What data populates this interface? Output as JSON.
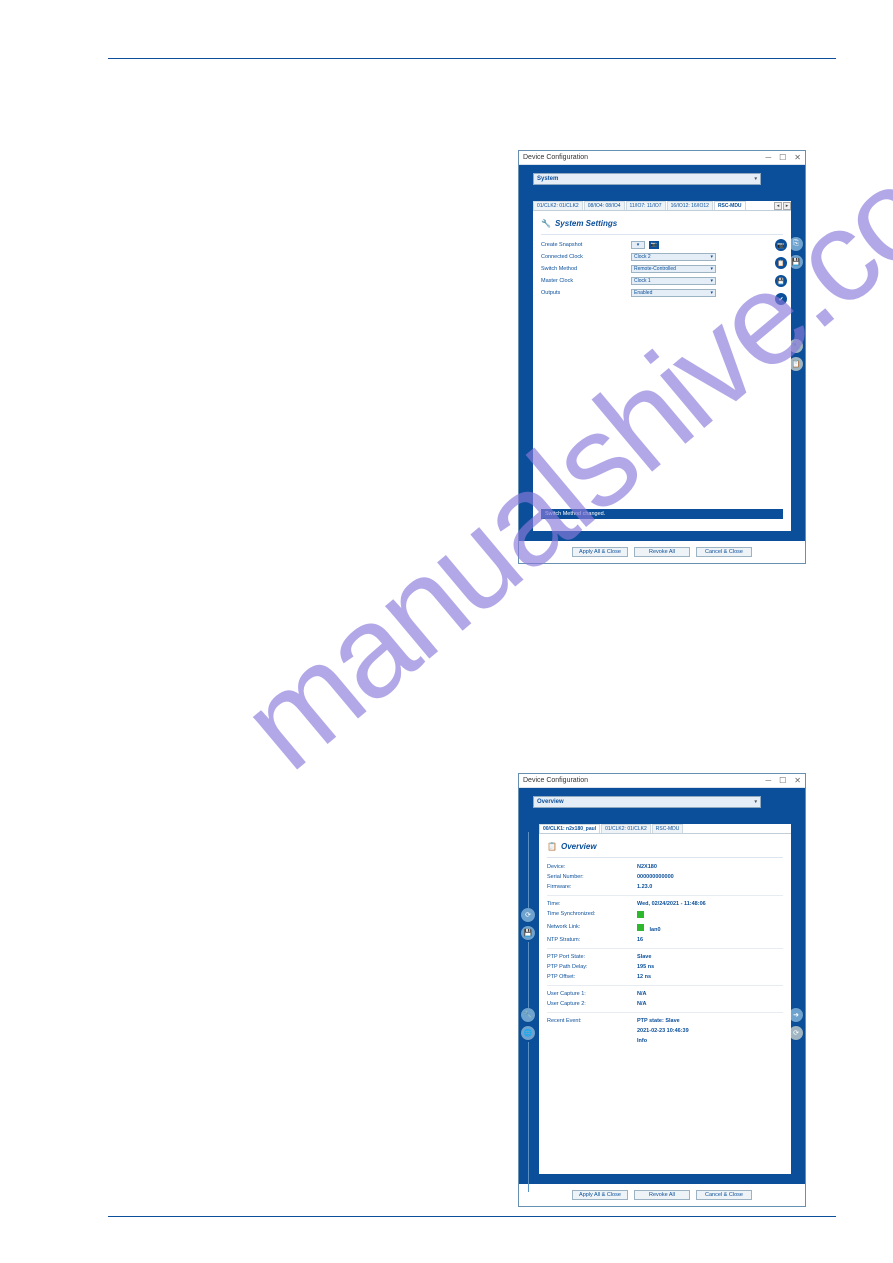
{
  "watermark": "manualshive.com",
  "win1": {
    "title": "Device Configuration",
    "dropdown": "System",
    "tabs": [
      "01/CLK2: 01/CLK2",
      "08/IO4: 08/IO4",
      "11/IO7: 11/IO7",
      "16/IO12: 16/IO12",
      "RSC-MDU"
    ],
    "active_tab_index": 4,
    "heading": "System Settings",
    "rows": {
      "create_snapshot": {
        "label": "Create Snapshot"
      },
      "connected_clock": {
        "label": "Connected Clock",
        "value": "Clock 2"
      },
      "switch_method": {
        "label": "Switch Method",
        "value": "Remote-Controlled"
      },
      "master_clock": {
        "label": "Master Clock",
        "value": "Clock 1"
      },
      "outputs": {
        "label": "Outputs",
        "value": "Enabled"
      }
    },
    "status": "Switch Method changed.",
    "buttons": {
      "apply": "Apply All & Close",
      "revoke": "Revoke All",
      "cancel": "Cancel & Close"
    }
  },
  "win2": {
    "title": "Device Configuration",
    "dropdown": "Overview",
    "tabs": [
      "00/CLK1: n2x180_paul",
      "01/CLK2: 01/CLK2",
      "RSC-MDU"
    ],
    "active_tab_index": 0,
    "heading": "Overview",
    "rows": {
      "device": {
        "label": "Device:",
        "value": "N2X180"
      },
      "serial": {
        "label": "Serial Number:",
        "value": "000000000000"
      },
      "firmware": {
        "label": "Firmware:",
        "value": "1.23.0"
      },
      "time": {
        "label": "Time:",
        "value": "Wed, 02/24/2021 - 11:48:06"
      },
      "tsync": {
        "label": "Time Synchronized:"
      },
      "nlink": {
        "label": "Network Link:",
        "value": "lan0"
      },
      "ntp": {
        "label": "NTP Stratum:",
        "value": "16"
      },
      "ptpstate": {
        "label": "PTP Port State:",
        "value": "Slave"
      },
      "ptpdelay": {
        "label": "PTP Path Delay:",
        "value": "195 ns"
      },
      "ptpoff": {
        "label": "PTP Offset:",
        "value": "12 ns"
      },
      "uc1": {
        "label": "User Capture 1:",
        "value": "N/A"
      },
      "uc2": {
        "label": "User Capture 2:",
        "value": "N/A"
      },
      "revent": {
        "label": "Recent Event:",
        "value1": "PTP state: Slave",
        "value2": "2021-02-23 10:46:39",
        "value3": "Info"
      }
    },
    "buttons": {
      "apply": "Apply All & Close",
      "revoke": "Revoke All",
      "cancel": "Cancel & Close"
    }
  }
}
